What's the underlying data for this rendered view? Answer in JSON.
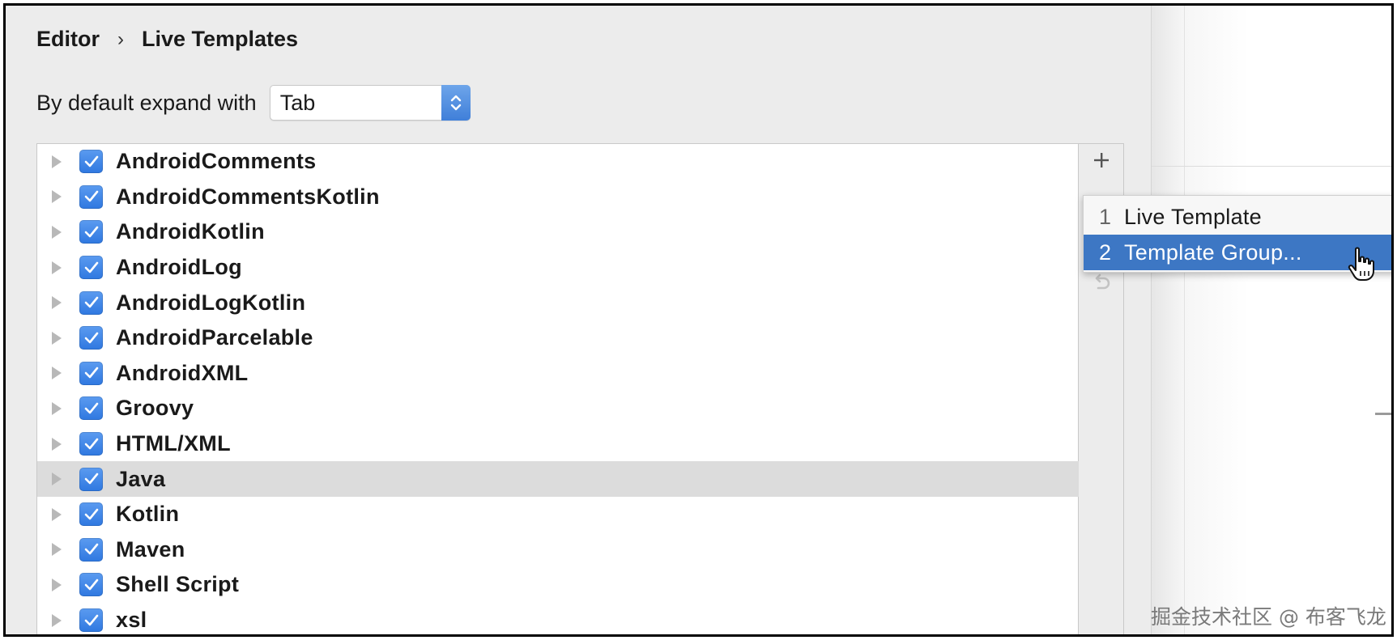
{
  "breadcrumb": {
    "parent": "Editor",
    "separator": "›",
    "current": "Live Templates"
  },
  "expand": {
    "label": "By default expand with",
    "selected": "Tab"
  },
  "template_groups": [
    {
      "label": "AndroidComments",
      "checked": true,
      "selected": false
    },
    {
      "label": "AndroidCommentsKotlin",
      "checked": true,
      "selected": false
    },
    {
      "label": "AndroidKotlin",
      "checked": true,
      "selected": false
    },
    {
      "label": "AndroidLog",
      "checked": true,
      "selected": false
    },
    {
      "label": "AndroidLogKotlin",
      "checked": true,
      "selected": false
    },
    {
      "label": "AndroidParcelable",
      "checked": true,
      "selected": false
    },
    {
      "label": "AndroidXML",
      "checked": true,
      "selected": false
    },
    {
      "label": "Groovy",
      "checked": true,
      "selected": false
    },
    {
      "label": "HTML/XML",
      "checked": true,
      "selected": false
    },
    {
      "label": "Java",
      "checked": true,
      "selected": true
    },
    {
      "label": "Kotlin",
      "checked": true,
      "selected": false
    },
    {
      "label": "Maven",
      "checked": true,
      "selected": false
    },
    {
      "label": "Shell Script",
      "checked": true,
      "selected": false
    },
    {
      "label": "xsl",
      "checked": true,
      "selected": false
    }
  ],
  "toolbar": {
    "add_icon": "plus-icon",
    "undo_icon": "undo-icon"
  },
  "add_menu": {
    "items": [
      {
        "number": "1",
        "label": "Live Template",
        "active": false
      },
      {
        "number": "2",
        "label": "Template Group...",
        "active": true
      }
    ]
  },
  "colors": {
    "accent": "#3d77c4",
    "checkbox": "#2f78e0",
    "selected_row": "#dcdcdc",
    "panel_bg": "#ececec"
  },
  "watermark": "掘金技术社区 @ 布客飞龙"
}
